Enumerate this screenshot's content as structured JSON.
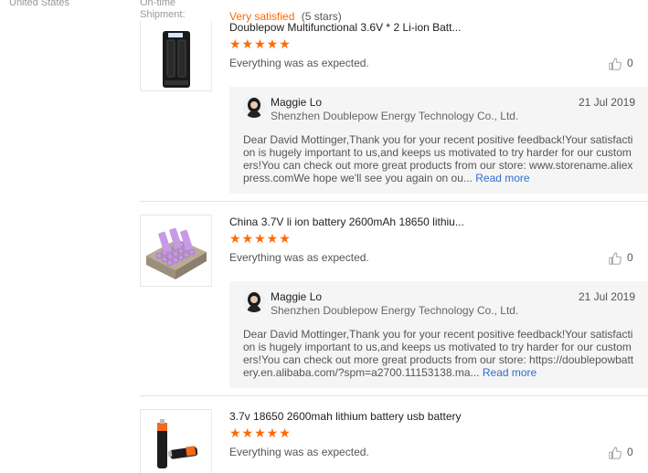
{
  "header": {
    "country": "United States",
    "ontime_label_line1": "On-time",
    "ontime_label_line2": "Shipment:",
    "satisfaction": "Very satisfied",
    "satisfaction_count": "(5 stars)"
  },
  "reviews": [
    {
      "product_title": "Doublepow Multifunctional 3.6V * 2 Li-ion Batt...",
      "stars": "★★★★★",
      "rating": 5,
      "text": "Everything was as expected.",
      "helpful_count": "0",
      "reply": {
        "seller_name": "Maggie Lo",
        "date": "21 Jul 2019",
        "company": "Shenzhen Doublepow Energy Technology Co., Ltd.",
        "message": "Dear David Mottinger,Thank you for your recent positive feedback!Your satisfaction is hugely important to us,and keeps us motivated to try harder for our customers!You can check out more great products from our store: www.storename.aliexpress.comWe hope we'll see you again on ou...",
        "read_more": "Read more"
      }
    },
    {
      "product_title": "China 3.7V li ion battery 2600mAh 18650 lithiu...",
      "stars": "★★★★★",
      "rating": 5,
      "text": "Everything was as expected.",
      "helpful_count": "0",
      "reply": {
        "seller_name": "Maggie Lo",
        "date": "21 Jul 2019",
        "company": "Shenzhen Doublepow Energy Technology Co., Ltd.",
        "message": "Dear David Mottinger,Thank you for your recent positive feedback!Your satisfaction is hugely important to us,and keeps us motivated to try harder for our customers!You can check out more great products from our store: https://doublepowbattery.en.alibaba.com/?spm=a2700.11153138.ma...",
        "read_more": "Read more"
      }
    },
    {
      "product_title": "3.7v 18650 2600mah lithium battery usb battery",
      "stars": "★★★★★",
      "rating": 5,
      "text": "Everything was as expected.",
      "helpful_count": "0"
    }
  ],
  "colors": {
    "accent": "#ff6a00",
    "link": "#2e6fd1",
    "reply_bg": "#f5f5f5"
  },
  "icons": {
    "helpful": "thumbs-up-icon",
    "avatar": "seller-avatar"
  }
}
